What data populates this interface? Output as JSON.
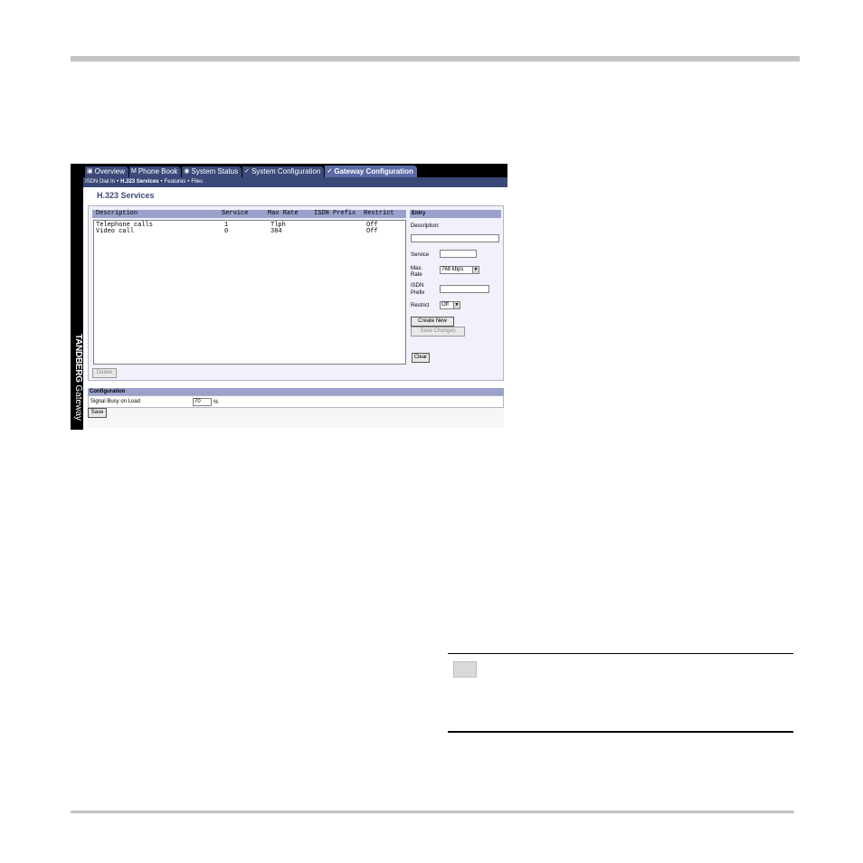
{
  "brand": {
    "name": "TANDBERG",
    "product": "Gateway"
  },
  "tabs": [
    {
      "icon": "▣",
      "label": "Overview",
      "active": false
    },
    {
      "icon": "M",
      "label": "Phone Book",
      "active": false
    },
    {
      "icon": "◉",
      "label": "System Status",
      "active": false
    },
    {
      "icon": "✓",
      "label": "System Configuration",
      "active": false
    },
    {
      "icon": "✓",
      "label": "Gateway Configuration",
      "active": true
    }
  ],
  "subnav": {
    "items": [
      "ISDN Dial In",
      "H.323 Services",
      "Features",
      "Files"
    ],
    "current_index": 1,
    "separator": "•"
  },
  "page_title": "H.323 Services",
  "services_list": {
    "columns": [
      "Description",
      "Service",
      "Max Rate",
      "ISDN Prefix",
      "Restrict"
    ],
    "rows": [
      {
        "description": "Telephone calls",
        "service": "1",
        "max_rate": "Tlph",
        "isdn_prefix": "",
        "restrict": "Off"
      },
      {
        "description": "Video call",
        "service": "0",
        "max_rate": "384",
        "isdn_prefix": "",
        "restrict": "Off"
      }
    ],
    "delete_label": "Delete"
  },
  "entry": {
    "title": "Entry",
    "description_label": "Description:",
    "description_value": "",
    "service_label": "Service",
    "service_value": "",
    "max_rate_label_1": "Max.",
    "max_rate_label_2": "Rate",
    "max_rate_value": "768 kbps",
    "isdn_prefix_label_1": "ISDN",
    "isdn_prefix_label_2": "Prefix",
    "isdn_prefix_value": "",
    "restrict_label": "Restrict",
    "restrict_value": "Off",
    "create_label": "Create New",
    "save_changes_label": "Save Changes",
    "clear_label": "Clear"
  },
  "configuration": {
    "title": "Configuration",
    "signal_busy_label": "Signal Busy on Load",
    "signal_busy_value": "70",
    "unit": "%",
    "save_label": "Save"
  }
}
